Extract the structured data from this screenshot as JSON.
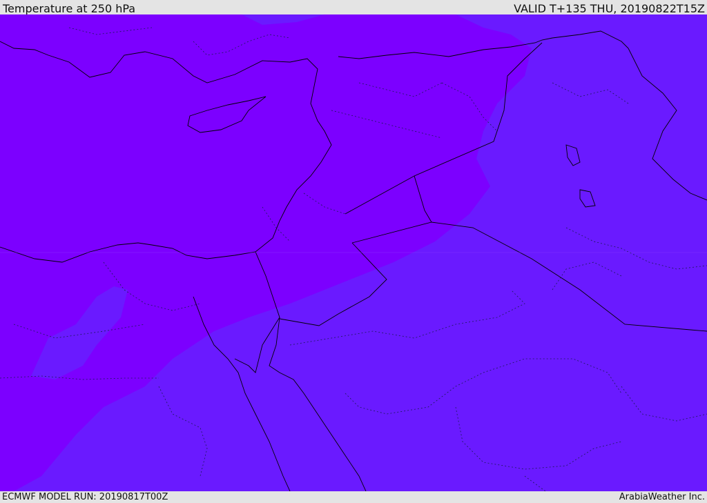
{
  "header": {
    "title": "Temperature at 250 hPa",
    "valid_time": "VALID T+135 THU, 20190822T15Z"
  },
  "footer": {
    "model_run": "ECMWF MODEL RUN: 20190817T00Z",
    "credit": "ArabiaWeather Inc."
  },
  "map": {
    "fill_colors": {
      "warm_band": "#7c00ff",
      "cool_band": "#6a1aff",
      "coastline": "#000000",
      "border": "#1a1a55"
    }
  }
}
